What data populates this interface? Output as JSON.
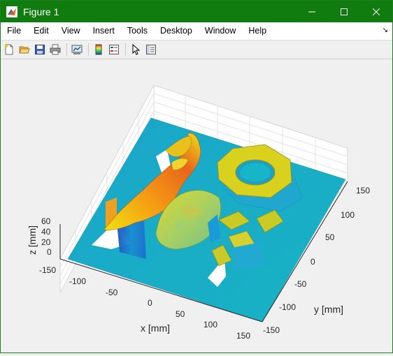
{
  "window": {
    "title": "Figure 1",
    "icon": "matlab-icon",
    "controls": [
      "minimize-icon",
      "maximize-icon",
      "close-icon"
    ]
  },
  "menu": [
    "File",
    "Edit",
    "View",
    "Insert",
    "Tools",
    "Desktop",
    "Window",
    "Help"
  ],
  "toolbar": [
    "new-figure-icon",
    "open-icon",
    "save-icon",
    "print-icon",
    "link-plot-icon",
    "colorbar-icon",
    "legend-icon",
    "pointer-icon",
    "property-inspector-icon"
  ],
  "chart_data": {
    "type": "surface3d",
    "xlabel": "x [mm]",
    "ylabel": "y [mm]",
    "zlabel": "z [mm]",
    "x_ticks": [
      "-150",
      "-100",
      "-50",
      "0",
      "50",
      "100",
      "150"
    ],
    "y_ticks": [
      "150",
      "100",
      "50",
      "0",
      "-50",
      "-100",
      "-150"
    ],
    "z_ticks": [
      "60",
      "40",
      "20",
      "0"
    ],
    "xlim": [
      -150,
      150
    ],
    "ylim": [
      -150,
      150
    ],
    "zlim": [
      0,
      60
    ],
    "colormap": "jet",
    "grid": true
  }
}
